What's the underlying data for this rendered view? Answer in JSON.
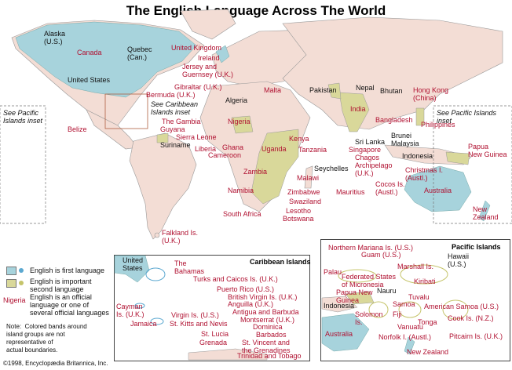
{
  "title": "The English Language Across The World",
  "colors": {
    "first": "#a7d3dc",
    "important": "#d9d89a",
    "land": "#f3ddd5",
    "official": "#b01030"
  },
  "labels": {
    "alaska": "Alaska\n(U.S.)",
    "canada": "Canada",
    "quebec": "Quebec\n(Can.)",
    "us": "United States",
    "uk": "United Kingdom",
    "ireland": "Ireland",
    "jersey": "Jersey and\nGuernsey (U.K.)",
    "gibraltar": "Gibraltar (U.K.)",
    "bermuda": "Bermuda (U.K.)",
    "see_caribbean": "See Caribbean\nIslands inset",
    "see_pacific_w": "See Pacific\nIslands inset",
    "see_pacific_e": "See Pacific Islands\ninset",
    "belize": "Belize",
    "gambia": "The Gambia",
    "guyana": "Guyana",
    "sierra_leone": "Sierra Leone",
    "suriname": "Suriname",
    "liberia": "Liberia",
    "ghana": "Ghana",
    "cameroon": "Cameroon",
    "malta": "Malta",
    "algeria": "Algeria",
    "nigeria": "Nigeria",
    "uganda": "Uganda",
    "kenya": "Kenya",
    "tanzania": "Tanzania",
    "zambia": "Zambia",
    "malawi": "Malawi",
    "namibia": "Namibia",
    "zimbabwe": "Zimbabwe",
    "swaziland": "Swaziland",
    "south_africa": "South Africa",
    "lesotho": "Lesotho",
    "botswana": "Botswana",
    "seychelles": "Seychelles",
    "mauritius": "Mauritius",
    "pakistan": "Pakistan",
    "nepal": "Nepal",
    "bhutan": "Bhutan",
    "india": "India",
    "bangladesh": "Bangladesh",
    "sri_lanka": "Sri Lanka",
    "singapore": "Singapore",
    "chagos": "Chagos\nArchipelago\n(U.K.)",
    "cocos": "Cocos Is.\n(Austl.)",
    "hong_kong": "Hong Kong\n(China)",
    "philippines": "Philippines",
    "brunei": "Brunei",
    "malaysia": "Malaysia",
    "indonesia": "Indonesia",
    "christmas": "Christmas I.\n(Austl.)",
    "papua": "Papua\nNew Guinea",
    "australia": "Australia",
    "new_zealand": "New\nZealand",
    "falkland": "Falkland Is.\n(U.K.)"
  },
  "legend": {
    "first": "English is first language",
    "important": "English is important\nsecond language",
    "official_word": "Nigeria",
    "official": "English is an official\nlanguage or one of\nseveral official languages",
    "note": "Note:  Colored bands around\nisland groups are not\nrepresentative of\nactual boundaries."
  },
  "caribbean": {
    "title": "Caribbean Islands",
    "united_states": "United\nStates",
    "bahamas": "The\nBahamas",
    "turks": "Turks and Caicos Is. (U.K.)",
    "puerto_rico": "Puerto Rico (U.S.)",
    "bvi": "British Virgin Is. (U.K.)",
    "anguilla": "Anguilla (U.K.)",
    "antigua": "Antigua and Barbuda",
    "cayman": "Cayman\nIs. (U.K.)",
    "virgin": "Virgin Is. (U.S.)",
    "montserrat": "Montserrat (U.K.)",
    "st_kitts": "St. Kitts and Nevis",
    "dominica": "Dominica",
    "jamaica": "Jamaica",
    "st_lucia": "St. Lucia",
    "barbados": "Barbados",
    "grenada": "Grenada",
    "st_vincent": "St. Vincent and\nthe Grenadines",
    "trinidad": "Trinidad and Tobago"
  },
  "pacific": {
    "title": "Pacific Islands",
    "northern_mariana": "Northern Mariana Is. (U.S.)",
    "guam": "Guam (U.S.)",
    "hawaii": "Hawaii\n(U.S.)",
    "palau": "Palau",
    "micronesia": "Federated States\nof Micronesia",
    "marshall": "Marshall Is.",
    "kiribati": "Kiribati",
    "png": "Papua New\nGuinea",
    "nauru": "Nauru",
    "indonesia": "Indonesia",
    "samoa": "Samoa",
    "tuvalu": "Tuvalu",
    "am_samoa": "American Samoa (U.S.)",
    "solomon": "Solomon\nIs.",
    "fiji": "Fiji",
    "tonga": "Tonga",
    "cook": "Cook Is. (N.Z.)",
    "vanuatu": "Vanuatu",
    "australia": "Australia",
    "norfolk": "Norfolk I. (Austl.)",
    "pitcairn": "Pitcairn Is. (U.K.)",
    "new_zealand": "New Zealand"
  },
  "copyright": "©1998, Encyclopædia Britannica, Inc."
}
